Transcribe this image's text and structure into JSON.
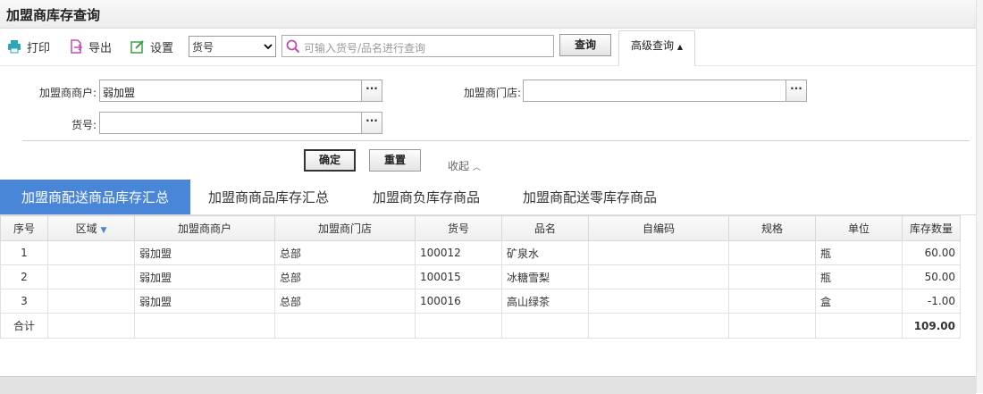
{
  "page": {
    "title": "加盟商库存查询"
  },
  "toolbar": {
    "print_label": "打印",
    "export_label": "导出",
    "settings_label": "设置",
    "select_value": "货号",
    "search_placeholder": "可输入货号/品名进行查询",
    "query_label": "查询",
    "advanced_label": "高级查询"
  },
  "filters": {
    "merchant_label": "加盟商商户:",
    "merchant_value": "弱加盟",
    "store_label": "加盟商门店:",
    "store_value": "",
    "sku_label": "货号:",
    "sku_value": "",
    "confirm_label": "确定",
    "reset_label": "重置",
    "collapse_label": "收起"
  },
  "tabs": [
    {
      "label": "加盟商配送商品库存汇总",
      "active": true
    },
    {
      "label": "加盟商商品库存汇总",
      "active": false
    },
    {
      "label": "加盟商负库存商品",
      "active": false
    },
    {
      "label": "加盟商配送零库存商品",
      "active": false
    }
  ],
  "table": {
    "headers": [
      "序号",
      "区域",
      "加盟商商户",
      "加盟商门店",
      "货号",
      "品名",
      "自编码",
      "规格",
      "单位",
      "库存数量"
    ],
    "rows": [
      [
        "1",
        "",
        "弱加盟",
        "总部",
        "100012",
        "矿泉水",
        "",
        "",
        "瓶",
        "60.00"
      ],
      [
        "2",
        "",
        "弱加盟",
        "总部",
        "100015",
        "冰糖雪梨",
        "",
        "",
        "瓶",
        "50.00"
      ],
      [
        "3",
        "",
        "弱加盟",
        "总部",
        "100016",
        "高山绿茶",
        "",
        "",
        "盒",
        "-1.00"
      ]
    ],
    "total_label": "合计",
    "total_value": "109.00"
  },
  "colors": {
    "accent": "#4a86d8",
    "icon_teal": "#2aa8b8",
    "icon_pink": "#c24ab8",
    "icon_green": "#3aa04a"
  }
}
